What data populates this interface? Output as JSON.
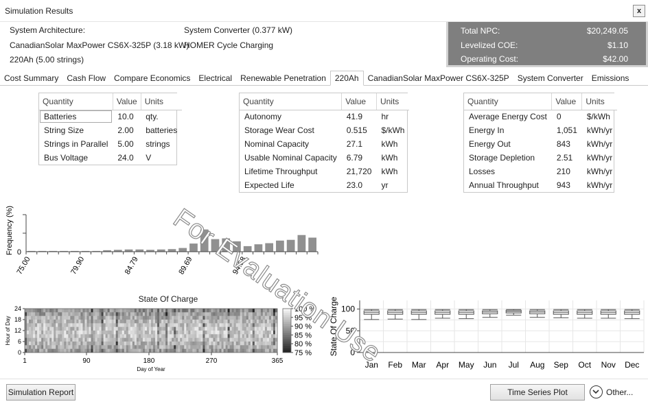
{
  "window": {
    "title": "Simulation Results",
    "close_label": "x"
  },
  "architecture": {
    "heading": "System Architecture:",
    "pv": "CanadianSolar MaxPower CS6X-325P (3.18 kW)",
    "battery": "220Ah (5.00 strings)",
    "converter": "System Converter (0.377 kW)",
    "dispatch": "HOMER Cycle Charging"
  },
  "summary": [
    {
      "label": "Total NPC:",
      "value": "$20,249.05"
    },
    {
      "label": "Levelized COE:",
      "value": "$1.10"
    },
    {
      "label": "Operating Cost:",
      "value": "$42.00"
    }
  ],
  "tabs": [
    "Cost Summary",
    "Cash Flow",
    "Compare Economics",
    "Electrical",
    "Renewable Penetration",
    "220Ah",
    "CanadianSolar MaxPower CS6X-325P",
    "System Converter",
    "Emissions"
  ],
  "active_tab": "220Ah",
  "table1": {
    "headers": [
      "Quantity",
      "Value",
      "Units"
    ],
    "rows": [
      [
        "Batteries",
        "10.0",
        "qty."
      ],
      [
        "String Size",
        "2.00",
        "batteries"
      ],
      [
        "Strings in Parallel",
        "5.00",
        "strings"
      ],
      [
        "Bus Voltage",
        "24.0",
        "V"
      ]
    ]
  },
  "table2": {
    "headers": [
      "Quantity",
      "Value",
      "Units"
    ],
    "rows": [
      [
        "Autonomy",
        "41.9",
        "hr"
      ],
      [
        "Storage Wear Cost",
        "0.515",
        "$/kWh"
      ],
      [
        "Nominal Capacity",
        "27.1",
        "kWh"
      ],
      [
        "Usable Nominal Capacity",
        "6.79",
        "kWh"
      ],
      [
        "Lifetime Throughput",
        "21,720",
        "kWh"
      ],
      [
        "Expected Life",
        "23.0",
        "yr"
      ]
    ]
  },
  "table3": {
    "headers": [
      "Quantity",
      "Value",
      "Units"
    ],
    "rows": [
      [
        "Average Energy Cost",
        "0",
        "$/kWh"
      ],
      [
        "Energy In",
        "1,051",
        "kWh/yr"
      ],
      [
        "Energy Out",
        "843",
        "kWh/yr"
      ],
      [
        "Storage Depletion",
        "2.51",
        "kWh/yr"
      ],
      [
        "Losses",
        "210",
        "kWh/yr"
      ],
      [
        "Annual Throughput",
        "943",
        "kWh/yr"
      ]
    ]
  },
  "watermark": "For Evaluation Use",
  "chart_data": [
    {
      "type": "bar",
      "ylabel": "Frequency (%)",
      "xlabel": "",
      "ytick_labels": [
        "0"
      ],
      "xtick_labels": [
        "75.00",
        "79.90",
        "84.79",
        "89.69",
        "94.58"
      ],
      "xtick_values": [
        75.0,
        79.9,
        84.79,
        89.69,
        94.58
      ],
      "bin_starts": [
        74.05,
        75.03,
        76.01,
        76.99,
        77.97,
        78.95,
        79.93,
        80.91,
        81.89,
        82.87,
        83.85,
        84.83,
        85.81,
        86.79,
        87.77,
        88.75,
        89.73,
        90.71,
        91.69,
        92.67,
        93.65,
        94.63,
        95.61,
        96.59,
        97.57,
        98.55
      ],
      "bin_width": 0.98,
      "values": [
        0.2,
        0.2,
        0.2,
        0.2,
        0.2,
        0.2,
        0.2,
        0.4,
        0.5,
        0.6,
        0.6,
        0.5,
        0.6,
        0.7,
        1.0,
        2.2,
        6.0,
        3.4,
        3.6,
        2.8,
        1.5,
        2.0,
        2.3,
        3.0,
        3.2,
        4.5,
        3.8
      ],
      "ylim": [
        0,
        10
      ],
      "color": "#909090"
    },
    {
      "type": "heatmap",
      "title": "State Of Charge",
      "xlabel": "Day of Year",
      "ylabel": "Hour of Day",
      "xticks": [
        1,
        90,
        180,
        270,
        365
      ],
      "yticks": [
        0,
        6,
        12,
        18,
        24
      ],
      "xlim": [
        1,
        365
      ],
      "ylim": [
        0,
        24
      ],
      "colorbar": [
        "100 %",
        "95 %",
        "90 %",
        "85 %",
        "80 %",
        "75 %"
      ],
      "colorscale": [
        "#1a1a1a",
        "#f4f4f4"
      ],
      "value_range": [
        75,
        100
      ]
    },
    {
      "type": "box",
      "ylabel": "State Of Charge",
      "categories": [
        "Jan",
        "Feb",
        "Mar",
        "Apr",
        "May",
        "Jun",
        "Jul",
        "Aug",
        "Sep",
        "Oct",
        "Nov",
        "Dec"
      ],
      "yticks": [
        0,
        50,
        100
      ],
      "ylim": [
        0,
        120
      ],
      "boxes": [
        {
          "min": 76,
          "q1": 88,
          "median": 92,
          "q3": 96,
          "max": 99
        },
        {
          "min": 77,
          "q1": 88,
          "median": 92,
          "q3": 96,
          "max": 99
        },
        {
          "min": 76,
          "q1": 88,
          "median": 92,
          "q3": 96,
          "max": 99
        },
        {
          "min": 79,
          "q1": 88,
          "median": 92,
          "q3": 96,
          "max": 99
        },
        {
          "min": 78,
          "q1": 88,
          "median": 92,
          "q3": 96,
          "max": 99
        },
        {
          "min": 81,
          "q1": 89,
          "median": 93,
          "q3": 96,
          "max": 99
        },
        {
          "min": 86,
          "q1": 91,
          "median": 94,
          "q3": 97,
          "max": 99
        },
        {
          "min": 81,
          "q1": 89,
          "median": 93,
          "q3": 96,
          "max": 99
        },
        {
          "min": 80,
          "q1": 88,
          "median": 92,
          "q3": 96,
          "max": 99
        },
        {
          "min": 79,
          "q1": 88,
          "median": 92,
          "q3": 96,
          "max": 99
        },
        {
          "min": 79,
          "q1": 88,
          "median": 92,
          "q3": 96,
          "max": 99
        },
        {
          "min": 78,
          "q1": 88,
          "median": 92,
          "q3": 96,
          "max": 99
        }
      ]
    }
  ],
  "footer": {
    "report_button": "Simulation Report",
    "timeseries_button": "Time Series Plot",
    "other_label": "Other..."
  }
}
